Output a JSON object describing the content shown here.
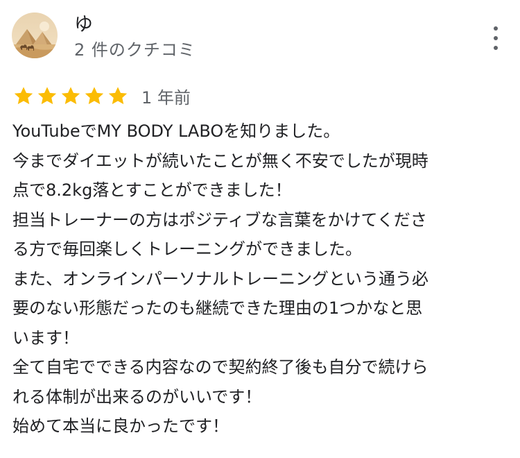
{
  "review": {
    "author_name": "ゆ",
    "author_review_count": "2 件のクチコミ",
    "rating": 5,
    "max_rating": 5,
    "date": "1 年前",
    "avatar_icon": "desert-pyramids-camel-photo",
    "more_icon": "more-vert-icon",
    "star_color": "#fbbc04",
    "lines": [
      "YouTubeでMY BODY LABOを知りました。",
      "今までダイエットが続いたことが無く不安でしたが現時",
      "点で8.2kg落とすことができました！",
      "担当トレーナーの方はポジティブな言葉をかけてくださ",
      "る方で毎回楽しくトレーニングができました。",
      "また、オンラインパーソナルトレーニングという通う必",
      "要のない形態だったのも継続できた理由の1つかなと思",
      "います！",
      "全て自宅でできる内容なので契約終了後も自分で続けら",
      "れる体制が出来るのがいいです！",
      "始めて本当に良かったです！"
    ]
  }
}
